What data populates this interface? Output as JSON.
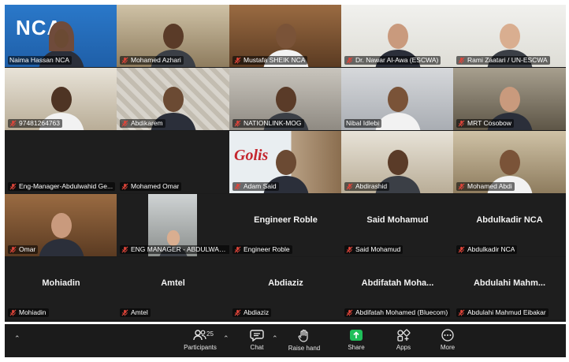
{
  "toolbar": {
    "participants_count": "25",
    "participants_label": "Participants",
    "chat_label": "Chat",
    "raise_hand_label": "Raise hand",
    "share_label": "Share",
    "apps_label": "Apps",
    "more_label": "More"
  },
  "tiles": [
    {
      "name": "Naima Hassan NCA",
      "muted": false,
      "active": true,
      "center": "",
      "scene": "nca"
    },
    {
      "name": "Mohamed Azhari",
      "muted": true,
      "active": false,
      "center": "",
      "scene": "room-warm"
    },
    {
      "name": "Mustafa SHEIK NCA",
      "muted": true,
      "active": false,
      "center": "",
      "scene": "room-wood"
    },
    {
      "name": "Dr. Nawar Al-Awa (ESCWA)",
      "muted": true,
      "active": false,
      "center": "",
      "scene": "escwa"
    },
    {
      "name": "Rami Zaatari / UN-ESCWA",
      "muted": true,
      "active": false,
      "center": "",
      "scene": "escwa"
    },
    {
      "name": "97481264763",
      "muted": true,
      "active": false,
      "center": "",
      "scene": "room-bright"
    },
    {
      "name": "Abdikarem",
      "muted": true,
      "active": false,
      "center": "",
      "scene": "room-pattern"
    },
    {
      "name": "NATIONLINK-MOG",
      "muted": true,
      "active": false,
      "center": "",
      "scene": "room-plain"
    },
    {
      "name": "Nibal Idlebi",
      "muted": false,
      "active": false,
      "center": "",
      "scene": "room-grey"
    },
    {
      "name": "MRT Cosobow",
      "muted": true,
      "active": false,
      "center": "",
      "scene": "room-dim"
    },
    {
      "name": "Eng-Manager-Abdulwahid Ge...",
      "muted": true,
      "active": false,
      "center": "",
      "scene": "dark"
    },
    {
      "name": "Mohamed Omar",
      "muted": true,
      "active": false,
      "center": "",
      "scene": "dark"
    },
    {
      "name": "Adam Said",
      "muted": true,
      "active": false,
      "center": "",
      "scene": "golis"
    },
    {
      "name": "Abdirashid",
      "muted": true,
      "active": false,
      "center": "",
      "scene": "room-bright"
    },
    {
      "name": "Mohamed Abdi",
      "muted": true,
      "active": false,
      "center": "",
      "scene": "room-warm"
    },
    {
      "name": "Omar",
      "muted": true,
      "active": false,
      "center": "",
      "scene": "room-wood"
    },
    {
      "name": "ENG MANAGER - ABDULWAHI...",
      "muted": true,
      "active": false,
      "center": "",
      "scene": "office-partial"
    },
    {
      "name": "Engineer Roble",
      "muted": true,
      "active": false,
      "center": "Engineer Roble",
      "scene": "none"
    },
    {
      "name": "Said Mohamud",
      "muted": true,
      "active": false,
      "center": "Said Mohamud",
      "scene": "none"
    },
    {
      "name": "Abdulkadir NCA",
      "muted": true,
      "active": false,
      "center": "Abdulkadir NCA",
      "scene": "none"
    },
    {
      "name": "Mohiadin",
      "muted": true,
      "active": false,
      "center": "Mohiadin",
      "scene": "none"
    },
    {
      "name": "Amtel",
      "muted": true,
      "active": false,
      "center": "Amtel",
      "scene": "none"
    },
    {
      "name": "Abdiaziz",
      "muted": true,
      "active": false,
      "center": "Abdiaziz",
      "scene": "none"
    },
    {
      "name": "Abdifatah Mohamed (Bluecom)",
      "muted": true,
      "active": false,
      "center": "Abdifatah Moha...",
      "scene": "none"
    },
    {
      "name": "Abdulahi Mahmud Eibakar",
      "muted": true,
      "active": false,
      "center": "Abdulahi Mahm...",
      "scene": "none"
    }
  ],
  "scene_text": {
    "nca_logo": "NCA",
    "golis_logo": "Golis"
  },
  "colors": {
    "active_border": "#23d96a",
    "mute_red": "#e0453a",
    "share_green": "#1fbf5a",
    "toolbar_bg": "#1b1b1b"
  }
}
